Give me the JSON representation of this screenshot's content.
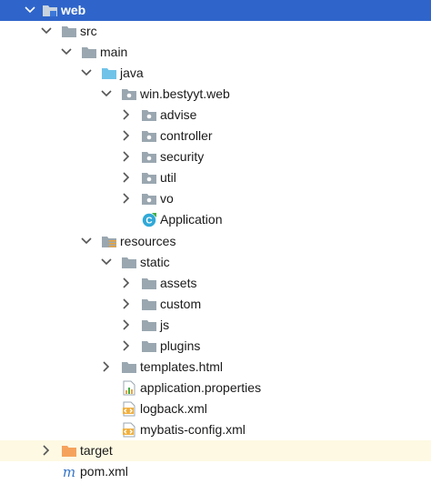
{
  "project_tree": {
    "web": "web",
    "src": "src",
    "main": "main",
    "java": "java",
    "package": "win.bestyyt.web",
    "advise": "advise",
    "controller": "controller",
    "security": "security",
    "util": "util",
    "vo": "vo",
    "application_class": "Application",
    "resources": "resources",
    "static": "static",
    "assets": "assets",
    "custom": "custom",
    "js": "js",
    "plugins": "plugins",
    "templates": "templates.html",
    "application_properties": "application.properties",
    "logback": "logback.xml",
    "mybatis_config": "mybatis-config.xml",
    "target": "target",
    "pom": "pom.xml",
    "class_badge": "C",
    "maven_badge": "m"
  },
  "colors": {
    "selection": "#2f65ca",
    "excluded_row": "#fdf9e3",
    "folder": "#9aa7b0",
    "source_folder": "#6fc3e8",
    "excluded_folder": "#f5a35c",
    "class_icon": "#30a9d8"
  }
}
